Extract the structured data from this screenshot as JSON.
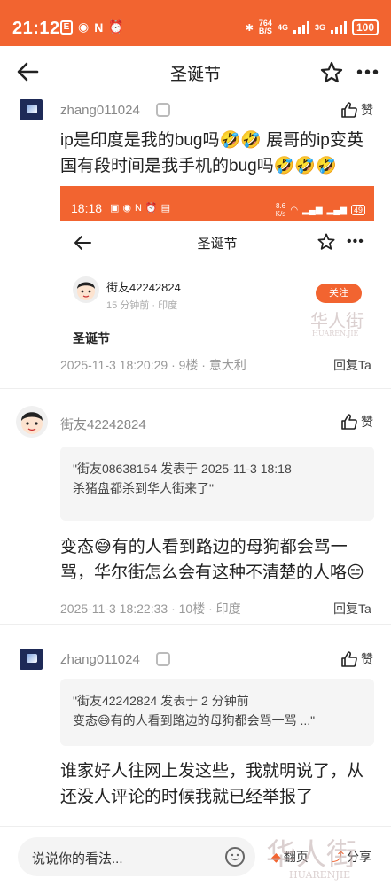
{
  "status_bar": {
    "time": "21:12",
    "net_speed_top": "764",
    "net_speed_bottom": "B/S",
    "signal_a": "4G",
    "signal_b": "3G",
    "battery": "100"
  },
  "nav": {
    "title": "圣诞节",
    "back_icon": "back-arrow-icon",
    "fav_icon": "star-icon",
    "more_icon": "more-icon"
  },
  "posts": [
    {
      "user": "zhang011024",
      "like_label": "赞",
      "text": "ip是印度是我的bug吗🤣🤣     展哥的ip变英国有段时间是我手机的bug吗🤣🤣🤣",
      "meta": "2025-11-3 18:20:29 · 9楼 · 意大利",
      "reply_label": "回复Ta",
      "embedded": {
        "time": "18:18",
        "speed_top": "8.6",
        "speed_bottom": "K/s",
        "battery": "49",
        "title": "圣诞节",
        "user": "街友42242824",
        "sub": "15 分钟前 · 印度",
        "follow_label": "关注",
        "caption": "圣诞节",
        "watermark": "HUAREN.JIE"
      }
    },
    {
      "user": "街友42242824",
      "like_label": "赞",
      "quote_line1": "\"街友08638154 发表于 2025-11-3 18:18",
      "quote_line2": "杀猪盘都杀到华人街来了\"",
      "text": "变态😅有的人看到路边的母狗都会骂一骂，华尔街怎么会有这种不清楚的人咯😑",
      "meta": "2025-11-3 18:22:33 · 10楼 · 印度",
      "reply_label": "回复Ta"
    },
    {
      "user": "zhang011024",
      "like_label": "赞",
      "quote_line1": "\"街友42242824 发表于 2 分钟前",
      "quote_line2": "变态😅有的人看到路边的母狗都会骂一骂 ...\"",
      "text": "谁家好人往网上发这些，我就明说了，从还没人评论的时候我就已经举报了"
    }
  ],
  "bottom": {
    "placeholder": "说说你的看法...",
    "page_label": "翻页",
    "share_label": "分享",
    "watermark_cn": "华人街",
    "watermark_en": "HUARENJIE"
  },
  "colors": {
    "accent": "#f26430",
    "status_bar": "#f26430"
  }
}
